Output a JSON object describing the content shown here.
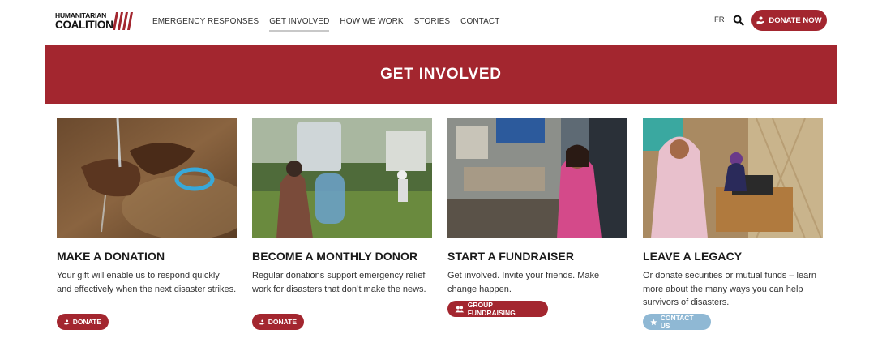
{
  "header": {
    "logo": {
      "line1": "HUMANITARIAN",
      "line2": "COALITION"
    },
    "nav": [
      {
        "label": "EMERGENCY RESPONSES"
      },
      {
        "label": "GET INVOLVED"
      },
      {
        "label": "HOW WE WORK"
      },
      {
        "label": "STORIES"
      },
      {
        "label": "CONTACT"
      }
    ],
    "lang": "FR",
    "donate_label": "DONATE NOW",
    "icons": [
      "search-icon",
      "donate-hand-icon"
    ]
  },
  "banner": {
    "title": "GET INVOLVED"
  },
  "cards": [
    {
      "title": "MAKE A DONATION",
      "text": "Your gift will enable us to respond quickly and effectively when the next disaster strikes.",
      "button": "DONATE",
      "button_icon": "donate-hand-icon"
    },
    {
      "title": "BECOME A MONTHLY DONOR",
      "text": "Regular donations support emergency relief work for disasters that don’t make the news.",
      "button": "DONATE",
      "button_icon": "donate-hand-icon"
    },
    {
      "title": "START A FUNDRAISER",
      "text": "Get involved. Invite your friends. Make change happen.",
      "button": "GROUP FUNDRAISING",
      "button_icon": "group-icon"
    },
    {
      "title": "LEAVE A LEGACY",
      "text": "Or donate securities or mutual funds – learn more about the many ways you can help survivors of disasters.",
      "button": "CONTACT US",
      "button_icon": "star-icon"
    }
  ],
  "colors": {
    "brand_red": "#a3262f",
    "light_blue": "#8fb8d4"
  }
}
